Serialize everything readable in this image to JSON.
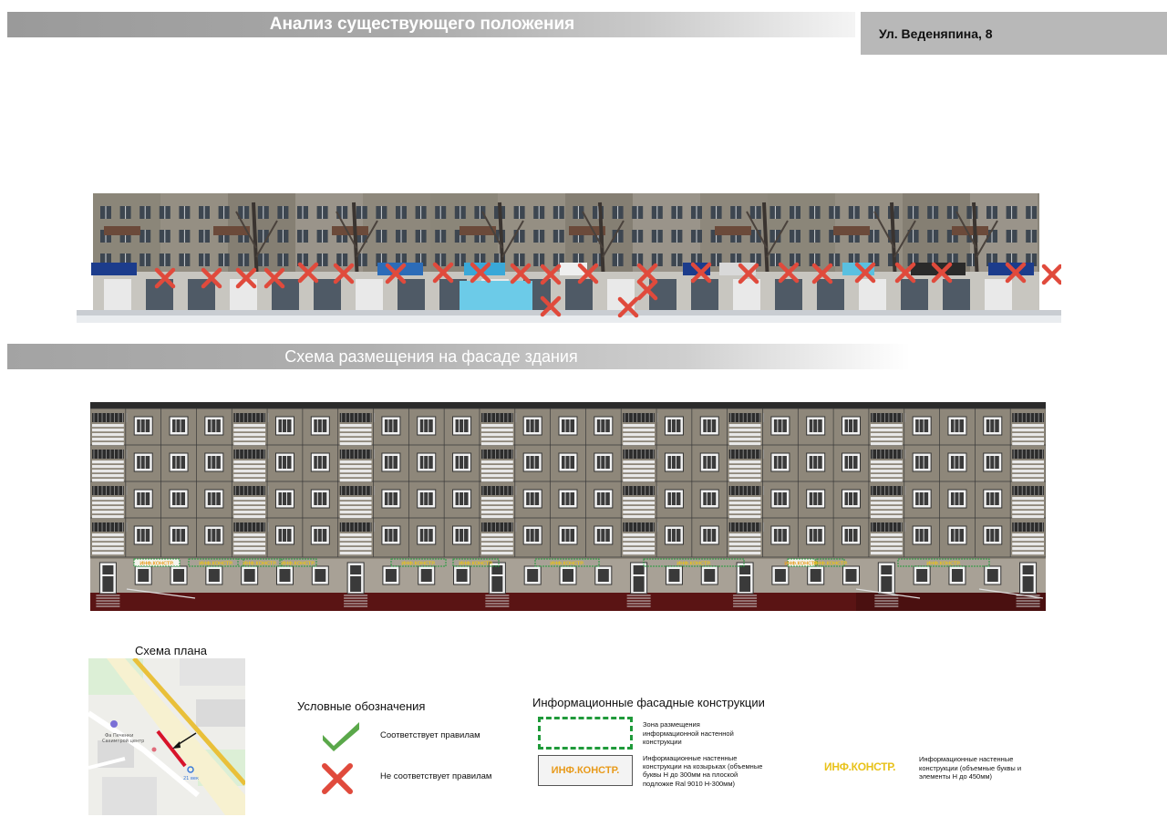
{
  "header": {
    "title": "Анализ существующего положения",
    "address": "Ул. Веденяпина, 8"
  },
  "scheme": {
    "title": "Схема размещения на фасаде здания"
  },
  "facade": {
    "sign_label": "ИНФ.КОНСТР."
  },
  "plan": {
    "title": "Схема плана"
  },
  "legend": {
    "title": "Условные обозначения",
    "ok_label": "Соответствует правилам",
    "bad_label": "Не соответствует правилам",
    "ok_color": "#5aa84a",
    "bad_color": "#e04a3c"
  },
  "info": {
    "title": "Информационные фасадные конструкции",
    "zone_text": "Зона размещения информационной настенной конструкции",
    "sign_label": "ИНФ.КОНСТР.",
    "sign_text": "Информационные настенные конструкции на козырьках (объемные буквы Н до 300мм на плоской подложке Ral 9010 Н-300мм)",
    "letters_label": "ИНФ.КОНСТР.",
    "letters_text": "Информационные настенные конструкции (объемные буквы и элементы Н до 450мм)"
  }
}
